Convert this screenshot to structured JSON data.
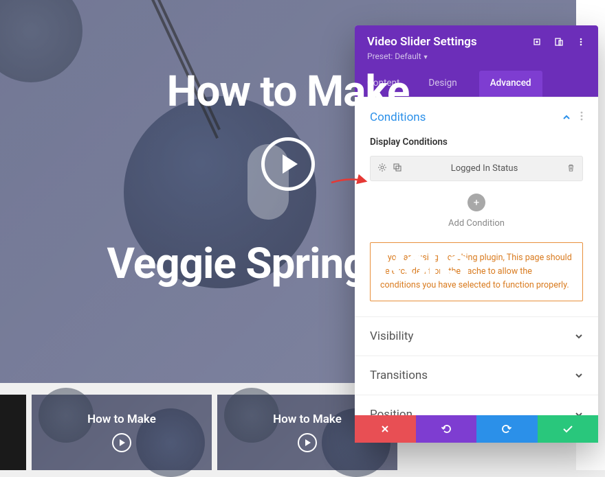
{
  "hero": {
    "title_line1": "How to Make",
    "title_line2": "Veggie Spring Rolls"
  },
  "thumbs": [
    {
      "title": "How to Make"
    },
    {
      "title": "How to Make"
    }
  ],
  "panel": {
    "title": "Video Slider Settings",
    "preset_label": "Preset: Default",
    "tabs": {
      "content": "Content",
      "design": "Design",
      "advanced": "Advanced"
    },
    "sections": {
      "conditions": {
        "title": "Conditions",
        "field_label": "Display Conditions",
        "item_label": "Logged In Status",
        "add_label": "Add Condition",
        "notice": "If you are using a caching plugin, This page should be excluded from the cache to allow the conditions you have selected to function properly."
      },
      "visibility": {
        "title": "Visibility"
      },
      "transitions": {
        "title": "Transitions"
      },
      "position": {
        "title": "Position"
      }
    }
  }
}
